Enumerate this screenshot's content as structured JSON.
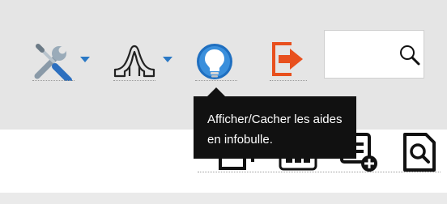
{
  "toolbar": {
    "tools_icon": "wrench-screwdriver-icon",
    "layout_icon": "tent-shape-icon",
    "help_icon": "lightbulb-icon",
    "logout_icon": "exit-arrow-icon",
    "search": {
      "value": "",
      "icon": "magnifier-icon"
    }
  },
  "tooltip": {
    "text": "Afficher/Cacher les aides en infobulle."
  },
  "secondary_toolbar": {
    "icons": [
      "copy-pages-icon",
      "keypad-icon",
      "add-list-icon",
      "document-search-icon"
    ]
  },
  "colors": {
    "toolbar_bg": "#e5e5e5",
    "accent_blue": "#2a78c5",
    "logout_orange": "#e8501e",
    "tooltip_bg": "#111111"
  }
}
